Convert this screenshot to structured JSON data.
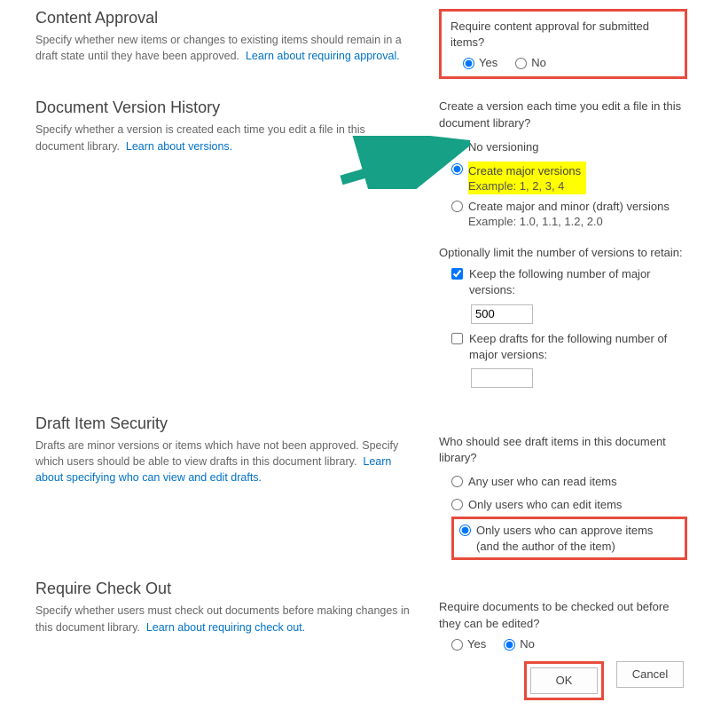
{
  "colors": {
    "accent": "#0072c6",
    "highlight": "#e74c3c",
    "hl_bg": "#ffff00",
    "arrow": "#16a085"
  },
  "contentApproval": {
    "title": "Content Approval",
    "desc": "Specify whether new items or changes to existing items should remain in a draft state until they have been approved.",
    "learnLink": "Learn about requiring approval.",
    "question": "Require content approval for submitted items?",
    "optYes": "Yes",
    "optNo": "No",
    "selected": "Yes"
  },
  "versionHistory": {
    "title": "Document Version History",
    "desc": "Specify whether a version is created each time you edit a file in this document library.",
    "learnLink": "Learn about versions.",
    "question": "Create a version each time you edit a file in this document library?",
    "optNone": "No versioning",
    "optMajor": "Create major versions",
    "exampleMajor": "Example: 1, 2, 3, 4",
    "optMajorMinor": "Create major and minor (draft) versions",
    "exampleMajorMinor": "Example: 1.0, 1.1, 1.2, 2.0",
    "selected": "major",
    "limitLabel": "Optionally limit the number of versions to retain:",
    "keepMajorLabel": "Keep the following number of major versions:",
    "keepMajorChecked": true,
    "keepMajorValue": "500",
    "keepDraftLabel": "Keep drafts for the following number of major versions:",
    "keepDraftChecked": false,
    "keepDraftValue": ""
  },
  "draftSecurity": {
    "title": "Draft Item Security",
    "desc": "Drafts are minor versions or items which have not been approved. Specify which users should be able to view drafts in this document library.",
    "learnLink": "Learn about specifying who can view and edit drafts.",
    "question": "Who should see draft items in this document library?",
    "optAny": "Any user who can read items",
    "optEdit": "Only users who can edit items",
    "optApprove": "Only users who can approve items (and the author of the item)",
    "selected": "approve"
  },
  "checkOut": {
    "title": "Require Check Out",
    "desc": "Specify whether users must check out documents before making changes in this document library.",
    "learnLink": "Learn about requiring check out.",
    "question": "Require documents to be checked out before they can be edited?",
    "optYes": "Yes",
    "optNo": "No",
    "selected": "No"
  },
  "buttons": {
    "ok": "OK",
    "cancel": "Cancel"
  }
}
